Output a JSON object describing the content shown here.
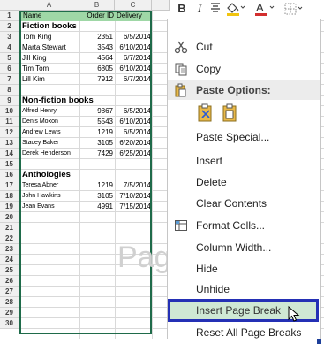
{
  "columns": [
    "A",
    "B",
    "C"
  ],
  "rows": [
    "1",
    "2",
    "3",
    "4",
    "5",
    "6",
    "7",
    "8",
    "9",
    "10",
    "11",
    "12",
    "13",
    "14",
    "15",
    "16",
    "17",
    "18",
    "19",
    "20",
    "21",
    "22",
    "23",
    "24",
    "25",
    "26",
    "27",
    "28",
    "29",
    "30"
  ],
  "header": {
    "name": "Name",
    "order_id": "Order ID",
    "delivery": "Delivery"
  },
  "sections": {
    "fiction": "Fiction books",
    "nonfiction": "Non-fiction books",
    "anthologies": "Anthologies"
  },
  "data": {
    "r3": [
      "Tom King",
      "2351",
      "6/5/2014"
    ],
    "r4": [
      "Marta Stewart",
      "3543",
      "6/10/2014"
    ],
    "r5": [
      "Jill King",
      "4564",
      "6/7/2014"
    ],
    "r6": [
      "Tim Tom",
      "6805",
      "6/10/2014"
    ],
    "r7": [
      "Lill Kim",
      "7912",
      "6/7/2014"
    ],
    "r10": [
      "Alfred Henry",
      "9867",
      "6/5/2014"
    ],
    "r11": [
      "Denis Moxon",
      "5543",
      "6/10/2014"
    ],
    "r12": [
      "Andrew Lewis",
      "1219",
      "6/5/2014"
    ],
    "r13": [
      "Stacey Baker",
      "3105",
      "6/20/2014"
    ],
    "r14": [
      "Derek Henderson",
      "7429",
      "6/25/2014"
    ],
    "r17": [
      "Teresa Abner",
      "1219",
      "7/5/2014"
    ],
    "r18": [
      "John Hawkins",
      "3105",
      "7/10/2014"
    ],
    "r19": [
      "Jean Evans",
      "4991",
      "7/15/2014"
    ]
  },
  "watermark": "Pag",
  "toolbar": {
    "bold": "B",
    "font_color_label": "A"
  },
  "menu": {
    "cut": "Cut",
    "copy": "Copy",
    "paste_options": "Paste Options:",
    "paste_special": "Paste Special...",
    "insert": "Insert",
    "delete": "Delete",
    "clear_contents": "Clear Contents",
    "format_cells": "Format Cells...",
    "column_width": "Column Width...",
    "hide": "Hide",
    "unhide": "Unhide",
    "insert_page_break": "Insert Page Break",
    "reset_all_page_breaks": "Reset All Page Breaks"
  },
  "colors": {
    "header_fill": "#9fd7a6",
    "highlight_border": "#2430b5",
    "page_break": "#1d3f9a"
  }
}
